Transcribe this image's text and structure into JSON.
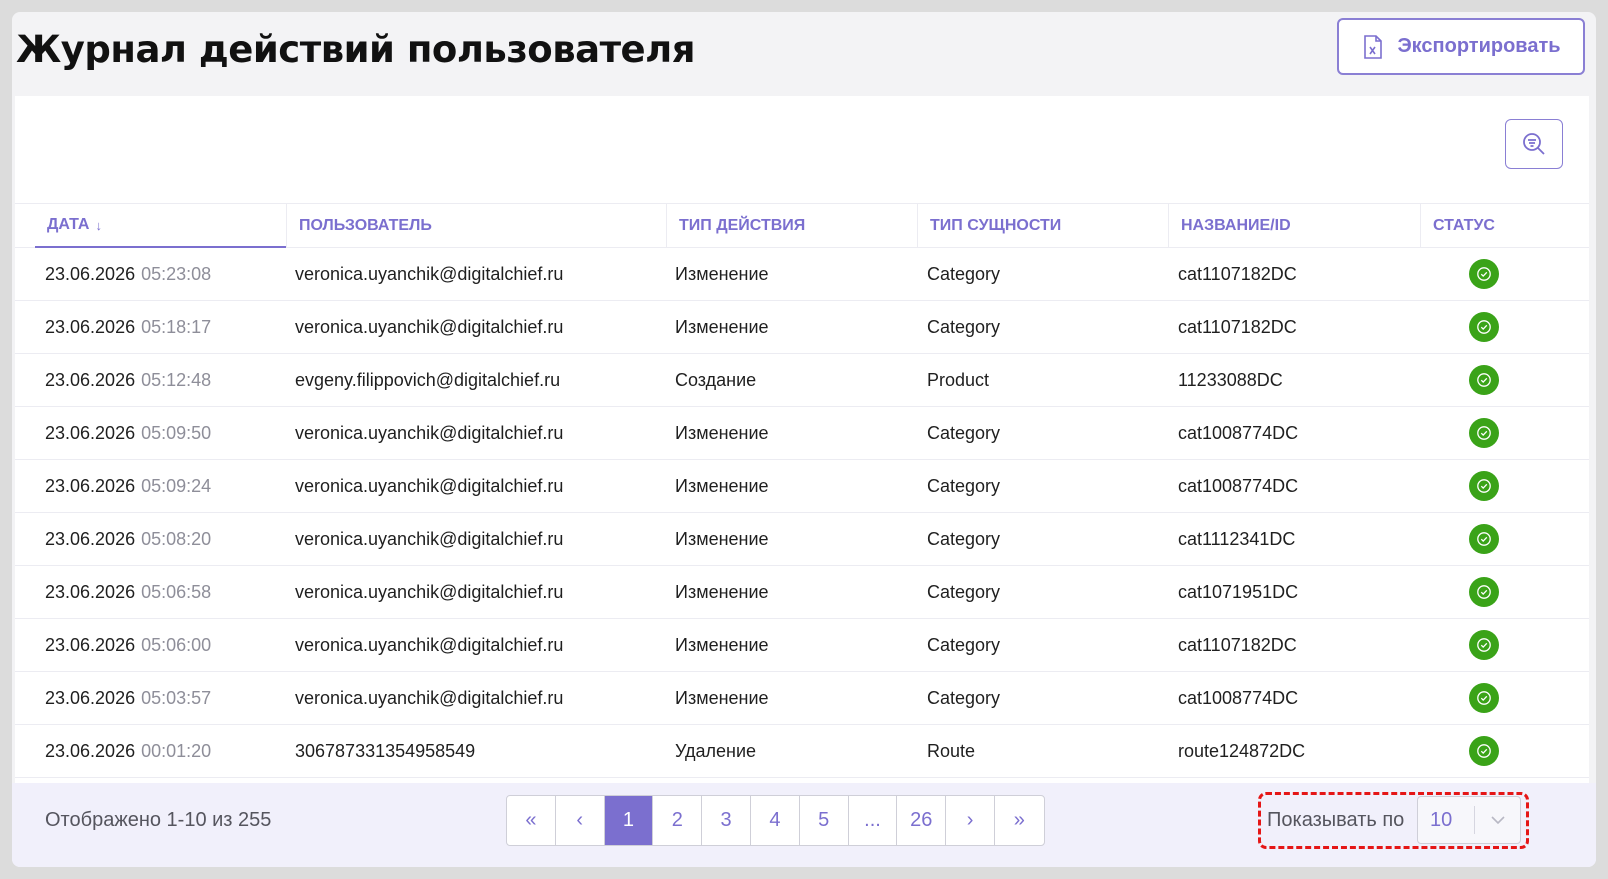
{
  "header": {
    "title": "Журнал действий пользователя",
    "export_label": "Экспортировать"
  },
  "icons": {
    "export": "excel-file-icon",
    "filter": "filter-search-icon",
    "status": "check-circle-icon",
    "sort": "arrow-down-icon"
  },
  "colors": {
    "accent": "#7b6fcf",
    "success": "#3aa318",
    "highlight": "#e51616"
  },
  "table": {
    "columns": [
      "Дата",
      "Пользователь",
      "Тип действия",
      "Тип сущности",
      "Название/ID",
      "Статус"
    ],
    "sort_indicator": "↓",
    "rows": [
      {
        "date": "23.06.2026",
        "time": "05:23:08",
        "user": "veronica.uyanchik@digitalchief.ru",
        "action": "Изменение",
        "entity": "Category",
        "name": "cat1107182DC"
      },
      {
        "date": "23.06.2026",
        "time": "05:18:17",
        "user": "veronica.uyanchik@digitalchief.ru",
        "action": "Изменение",
        "entity": "Category",
        "name": "cat1107182DC"
      },
      {
        "date": "23.06.2026",
        "time": "05:12:48",
        "user": "evgeny.filippovich@digitalchief.ru",
        "action": "Создание",
        "entity": "Product",
        "name": "11233088DC"
      },
      {
        "date": "23.06.2026",
        "time": "05:09:50",
        "user": "veronica.uyanchik@digitalchief.ru",
        "action": "Изменение",
        "entity": "Category",
        "name": "cat1008774DC"
      },
      {
        "date": "23.06.2026",
        "time": "05:09:24",
        "user": "veronica.uyanchik@digitalchief.ru",
        "action": "Изменение",
        "entity": "Category",
        "name": "cat1008774DC"
      },
      {
        "date": "23.06.2026",
        "time": "05:08:20",
        "user": "veronica.uyanchik@digitalchief.ru",
        "action": "Изменение",
        "entity": "Category",
        "name": "cat1112341DC"
      },
      {
        "date": "23.06.2026",
        "time": "05:06:58",
        "user": "veronica.uyanchik@digitalchief.ru",
        "action": "Изменение",
        "entity": "Category",
        "name": "cat1071951DC"
      },
      {
        "date": "23.06.2026",
        "time": "05:06:00",
        "user": "veronica.uyanchik@digitalchief.ru",
        "action": "Изменение",
        "entity": "Category",
        "name": "cat1107182DC"
      },
      {
        "date": "23.06.2026",
        "time": "05:03:57",
        "user": "veronica.uyanchik@digitalchief.ru",
        "action": "Изменение",
        "entity": "Category",
        "name": "cat1008774DC"
      },
      {
        "date": "23.06.2026",
        "time": "00:01:20",
        "user": "306787331354958549",
        "action": "Удаление",
        "entity": "Route",
        "name": "route124872DC"
      }
    ]
  },
  "footer": {
    "summary": "Отображено 1-10 из 255",
    "pages": [
      "«",
      "‹",
      "1",
      "2",
      "3",
      "4",
      "5",
      "...",
      "26",
      "›",
      "»"
    ],
    "active_page": "1",
    "per_page_label": "Показывать по",
    "per_page_value": "10"
  }
}
